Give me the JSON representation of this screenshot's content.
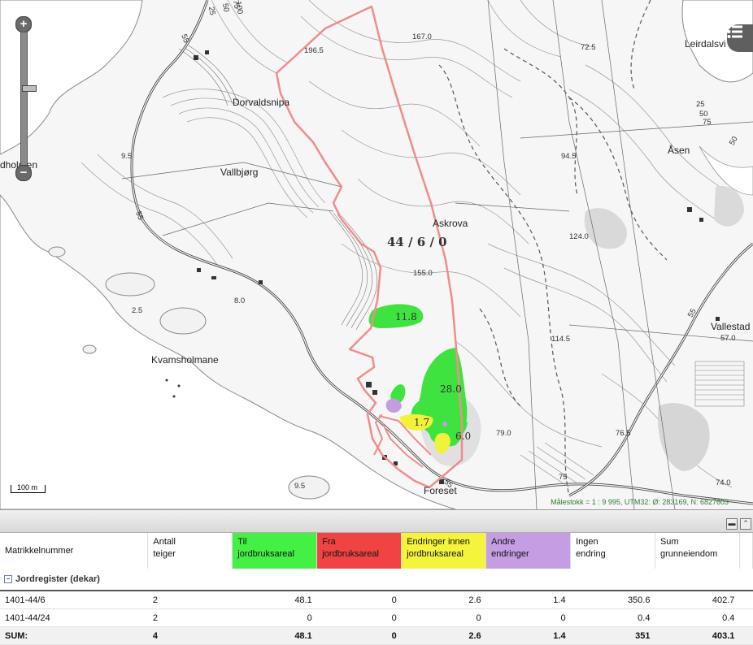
{
  "map": {
    "place_names": [
      {
        "name": "Dorvaldsnipa"
      },
      {
        "name": "Vallbjørg"
      },
      {
        "name": "Askrova"
      },
      {
        "name": "Kvamsholmane"
      },
      {
        "name": "Leirdalsvi"
      },
      {
        "name": "Åsen"
      },
      {
        "name": "Vallestad"
      },
      {
        "name": "Foreset"
      },
      {
        "name": "dholmen"
      }
    ],
    "spot_heights": [
      "196.5",
      "167.0",
      "72.5",
      "94.5",
      "124.0",
      "155.0",
      "114.5",
      "79.0",
      "76.5",
      "74.0",
      "57.0",
      "9.5",
      "8.0",
      "2.5",
      "9.5",
      "75"
    ],
    "contour_labels": [
      "25",
      "50",
      "75",
      "100",
      "25",
      "50",
      "75",
      "50"
    ],
    "road_labels": [
      "55",
      "55",
      "55",
      "55"
    ],
    "property_label": "44 / 6 / 0",
    "area_labels": [
      "11.8",
      "28.0",
      "1.7",
      "6.0"
    ],
    "scale_bar": "100 m",
    "scale_info": "Målestokk = 1 : 9 995, UTM32: Ø: 283169, N: 6827603",
    "zoom_in": "+",
    "zoom_out": "−",
    "colors": {
      "green_area": "#3fe33f",
      "yellow_area": "#f2f23a",
      "purple_area": "#c39de0",
      "boundary": "#f08c8c"
    }
  },
  "table": {
    "headers": [
      {
        "line1": "Matrikkelnummer",
        "line2": "",
        "color": ""
      },
      {
        "line1": "Antall",
        "line2": "teiger",
        "color": ""
      },
      {
        "line1": "Til",
        "line2": "jordbruksareal",
        "color": "#44f044"
      },
      {
        "line1": "Fra",
        "line2": "jordbruksareal",
        "color": "#f04444"
      },
      {
        "line1": "Endringer innen",
        "line2": "jordbruksareal",
        "color": "#f4f43c"
      },
      {
        "line1": "Andre",
        "line2": "endringer",
        "color": "#c49de2"
      },
      {
        "line1": "Ingen",
        "line2": "endring",
        "color": ""
      },
      {
        "line1": "Sum",
        "line2": "grunneiendom",
        "color": ""
      }
    ],
    "group_label": "Jordregister (dekar)",
    "rows": [
      {
        "matrikkel": "1401-44/6",
        "teiger": "2",
        "til": "48.1",
        "fra": "0",
        "innen": "2.6",
        "andre": "1.4",
        "ingen": "350.6",
        "sum": "402.7"
      },
      {
        "matrikkel": "1401-44/24",
        "teiger": "2",
        "til": "0",
        "fra": "0",
        "innen": "0",
        "andre": "0",
        "ingen": "0.4",
        "sum": "0.4"
      }
    ],
    "sum_row": {
      "matrikkel": "SUM:",
      "teiger": "4",
      "til": "48.1",
      "fra": "0",
      "innen": "2.6",
      "andre": "1.4",
      "ingen": "351",
      "sum": "403.1"
    }
  }
}
